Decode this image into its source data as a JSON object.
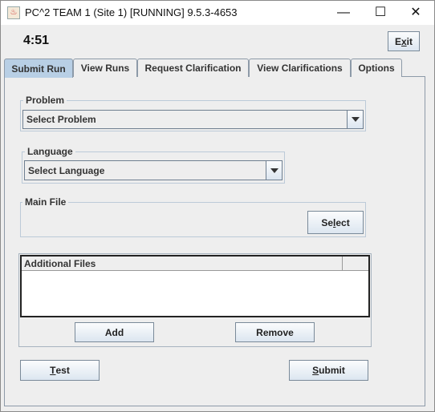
{
  "window": {
    "title": "PC^2 TEAM 1 (Site 1) [RUNNING] 9.5.3-4653"
  },
  "timer": "4:51",
  "exit": {
    "pre": "E",
    "key": "x",
    "post": "it"
  },
  "tabs": [
    {
      "label": "Submit Run",
      "selected": true
    },
    {
      "label": "View Runs"
    },
    {
      "label": "Request Clarification"
    },
    {
      "label": "View Clarifications"
    },
    {
      "label": "Options"
    }
  ],
  "problem": {
    "legend": "Problem",
    "value": "Select Problem"
  },
  "language": {
    "legend": "Language",
    "value": "Select Language"
  },
  "main_file": {
    "legend": "Main File",
    "select": {
      "pre": "Se",
      "key": "l",
      "post": "ect"
    }
  },
  "additional_files": {
    "header": "Additional Files",
    "add": "Add",
    "remove": "Remove"
  },
  "test": {
    "pre": "",
    "key": "T",
    "post": "est"
  },
  "submit": {
    "pre": "",
    "key": "S",
    "post": "ubmit"
  }
}
